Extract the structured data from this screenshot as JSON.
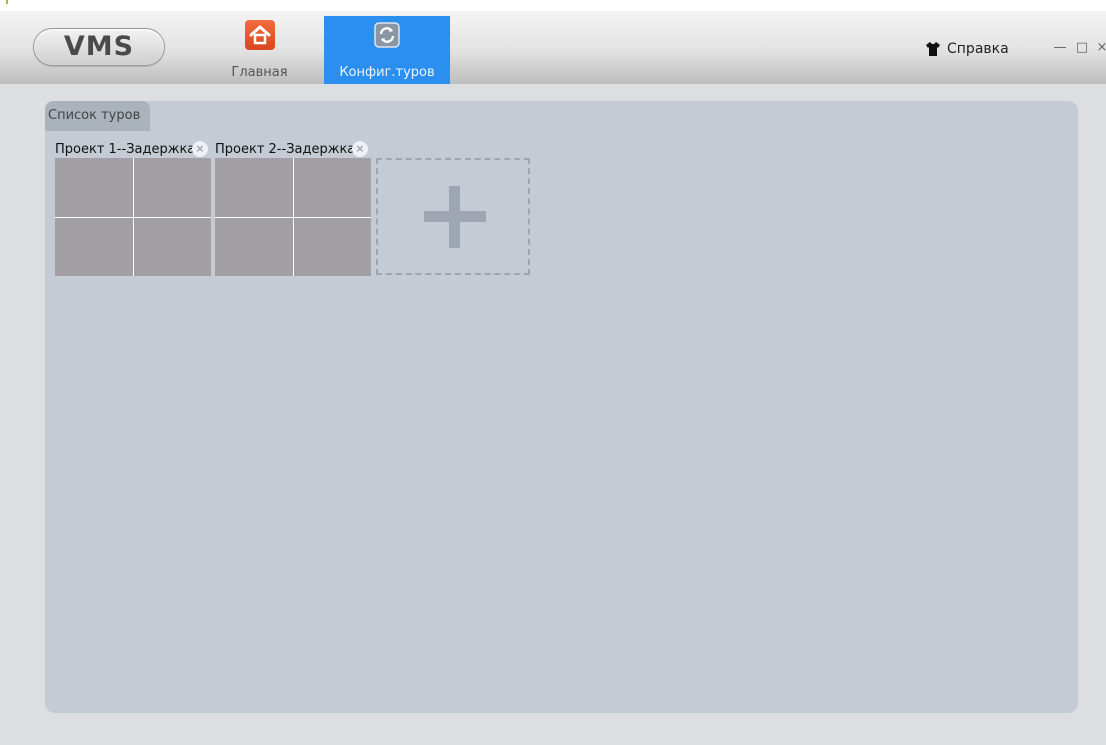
{
  "app": {
    "logo_text": "VMS"
  },
  "nav": {
    "tabs": [
      {
        "label": "Главная",
        "icon": "home-icon",
        "active": false
      },
      {
        "label": "Конфиг.туров",
        "icon": "refresh-icon",
        "active": true
      }
    ]
  },
  "header": {
    "help_label": "Справка",
    "help_icon": "shirt-icon",
    "minimize_glyph": "—",
    "maximize_glyph": "□",
    "close_glyph": "×"
  },
  "panel": {
    "tab_label": "Список туров",
    "tours": [
      {
        "title": "Проект 1--Задержка",
        "close_glyph": "×",
        "cells": 4
      },
      {
        "title": "Проект 2--Задержка",
        "close_glyph": "×",
        "cells": 4
      }
    ],
    "add_icon": "plus-icon"
  },
  "colors": {
    "accent": "#2b8ff0",
    "home_icon": "#e8572d",
    "panel_bg": "#c4cbd4",
    "cell": "#a29fa4"
  }
}
